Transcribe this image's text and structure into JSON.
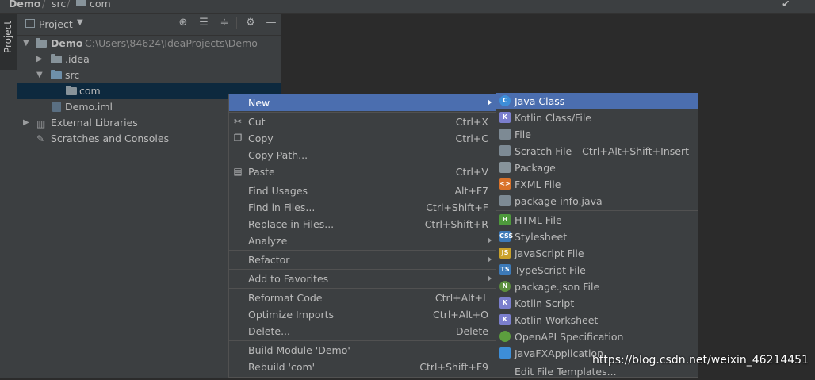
{
  "breadcrumb": {
    "project": "Demo",
    "sep": "/",
    "src": "src",
    "com": "com"
  },
  "sidebar_tab": "Project",
  "panel": {
    "title": "Project"
  },
  "tree": {
    "root_label": "Demo",
    "root_path": "C:\\Users\\84624\\IdeaProjects\\Demo",
    "idea": ".idea",
    "src": "src",
    "com": "com",
    "iml": "Demo.iml",
    "external": "External Libraries",
    "scratches": "Scratches and Consoles"
  },
  "menu": [
    {
      "label": "New",
      "shortcut": "",
      "submenu": true,
      "selected": true
    },
    {
      "label": "Cut",
      "shortcut": "Ctrl+X",
      "icon": "cut-icon"
    },
    {
      "label": "Copy",
      "shortcut": "Ctrl+C",
      "icon": "copy-icon"
    },
    {
      "label": "Copy Path...",
      "shortcut": ""
    },
    {
      "label": "Paste",
      "shortcut": "Ctrl+V",
      "icon": "paste-icon"
    },
    {
      "label": "Find Usages",
      "shortcut": "Alt+F7"
    },
    {
      "label": "Find in Files...",
      "shortcut": "Ctrl+Shift+F"
    },
    {
      "label": "Replace in Files...",
      "shortcut": "Ctrl+Shift+R"
    },
    {
      "label": "Analyze",
      "shortcut": "",
      "submenu": true
    },
    {
      "label": "Refactor",
      "shortcut": "",
      "submenu": true
    },
    {
      "label": "Add to Favorites",
      "shortcut": "",
      "submenu": true
    },
    {
      "label": "Reformat Code",
      "shortcut": "Ctrl+Alt+L"
    },
    {
      "label": "Optimize Imports",
      "shortcut": "Ctrl+Alt+O"
    },
    {
      "label": "Delete...",
      "shortcut": "Delete"
    },
    {
      "label": "Build Module 'Demo'",
      "shortcut": ""
    },
    {
      "label": "Rebuild 'com'",
      "shortcut": "Ctrl+Shift+F9"
    }
  ],
  "submenu": [
    {
      "label": "Java Class",
      "shortcut": "",
      "icon": "java-class-icon",
      "color": "#3d8ed8",
      "glyph": "C",
      "selected": true
    },
    {
      "label": "Kotlin Class/File",
      "shortcut": "",
      "icon": "kotlin-file-icon",
      "color": "#7b7fce",
      "glyph": "K"
    },
    {
      "label": "File",
      "shortcut": "",
      "icon": "file-icon",
      "color": "#7d8a94",
      "glyph": ""
    },
    {
      "label": "Scratch File",
      "shortcut": "Ctrl+Alt+Shift+Insert",
      "icon": "scratch-file-icon",
      "color": "#7d8a94",
      "glyph": ""
    },
    {
      "label": "Package",
      "shortcut": "",
      "icon": "package-icon",
      "color": "#87939a",
      "glyph": ""
    },
    {
      "label": "FXML File",
      "shortcut": "",
      "icon": "fxml-file-icon",
      "color": "#d9722a",
      "glyph": "<>"
    },
    {
      "label": "package-info.java",
      "shortcut": "",
      "icon": "package-info-icon",
      "color": "#7d8a94",
      "glyph": ""
    },
    {
      "label": "HTML File",
      "shortcut": "",
      "icon": "html-file-icon",
      "color": "#4e9a3c",
      "glyph": "H"
    },
    {
      "label": "Stylesheet",
      "shortcut": "",
      "icon": "stylesheet-icon",
      "color": "#3d7ab8",
      "glyph": "CSS"
    },
    {
      "label": "JavaScript File",
      "shortcut": "",
      "icon": "javascript-file-icon",
      "color": "#c9a12a",
      "glyph": "JS"
    },
    {
      "label": "TypeScript File",
      "shortcut": "",
      "icon": "typescript-file-icon",
      "color": "#3d7ab8",
      "glyph": "TS"
    },
    {
      "label": "package.json File",
      "shortcut": "",
      "icon": "package-json-icon",
      "color": "#5c8f3e",
      "glyph": "N"
    },
    {
      "label": "Kotlin Script",
      "shortcut": "",
      "icon": "kotlin-script-icon",
      "color": "#7b7fce",
      "glyph": "K"
    },
    {
      "label": "Kotlin Worksheet",
      "shortcut": "",
      "icon": "kotlin-worksheet-icon",
      "color": "#7b7fce",
      "glyph": "K"
    },
    {
      "label": "OpenAPI Specification",
      "shortcut": "",
      "icon": "openapi-icon",
      "color": "#5c9e3e",
      "glyph": ""
    },
    {
      "label": "JavaFXApplication",
      "shortcut": "",
      "icon": "javafx-icon",
      "color": "#3d8ed8",
      "glyph": ""
    },
    {
      "label": "Edit File Templates...",
      "shortcut": "",
      "icon": "",
      "color": "",
      "glyph": ""
    }
  ],
  "watermark": "https://blog.csdn.net/weixin_46214451"
}
